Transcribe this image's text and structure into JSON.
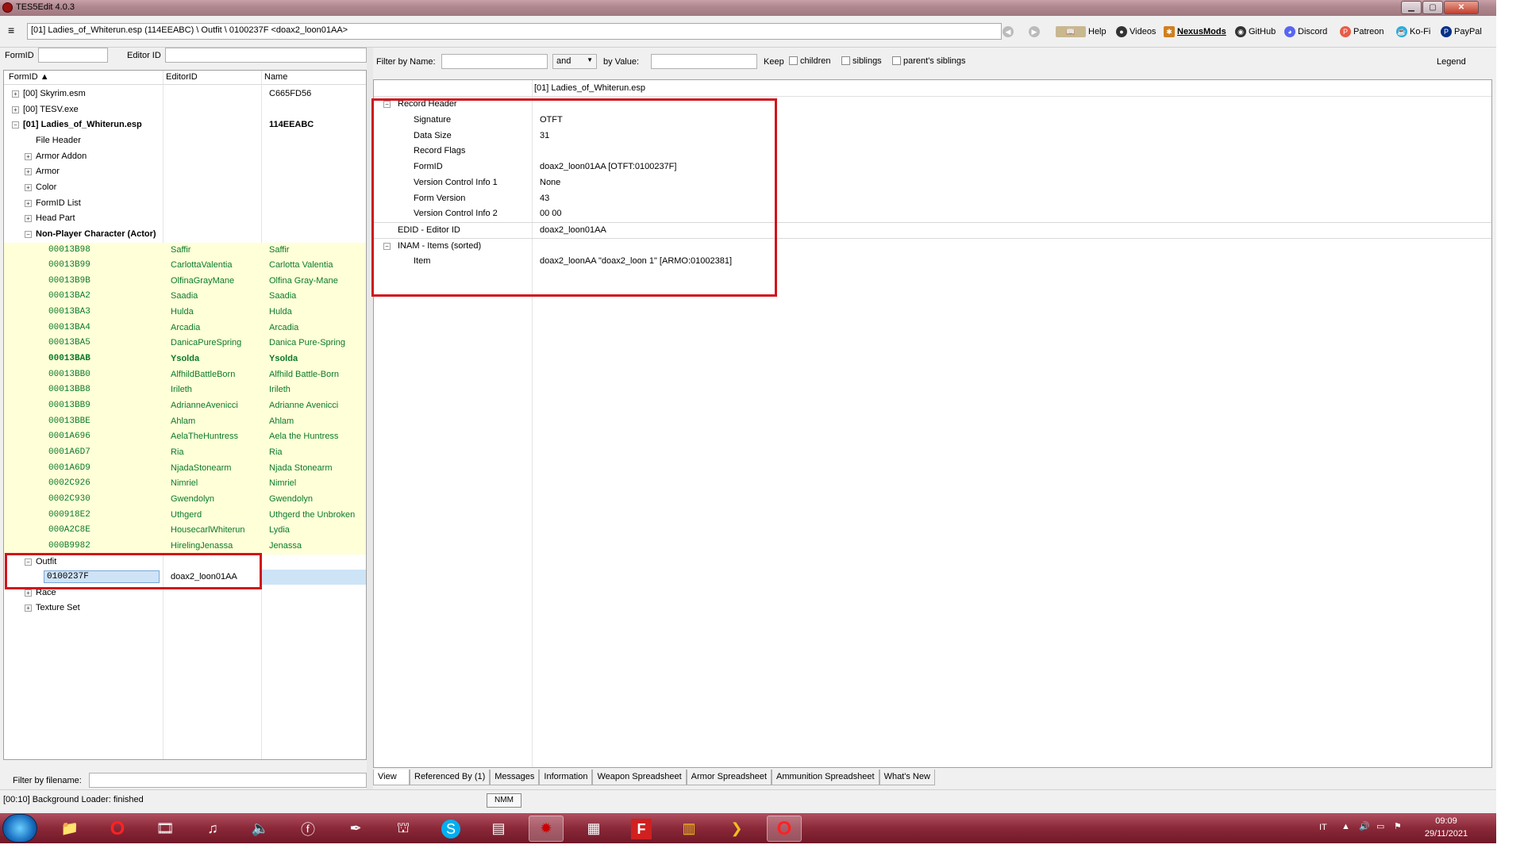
{
  "window": {
    "title": "TES5Edit 4.0.3"
  },
  "toolbar": {
    "path": "[01] Ladies_of_Whiterun.esp (114EEABC) \\ Outfit \\ 0100237F <doax2_loon01AA>",
    "links": [
      "Help",
      "Videos",
      "NexusMods",
      "GitHub",
      "Discord",
      "Patreon",
      "Ko-Fi",
      "PayPal"
    ]
  },
  "left": {
    "formid_label": "FormID",
    "editorid_label": "Editor ID",
    "columns": [
      "FormID",
      "EditorID",
      "Name"
    ],
    "filter_filename_label": "Filter by filename:"
  },
  "tree": [
    {
      "level": 0,
      "exp": "+",
      "fid": "[00] Skyrim.esm",
      "eid": "",
      "name": "C665FD56",
      "type": "file"
    },
    {
      "level": 0,
      "exp": "+",
      "fid": "[00] TESV.exe",
      "eid": "",
      "name": "",
      "type": "file"
    },
    {
      "level": 0,
      "exp": "-",
      "fid": "[01] Ladies_of_Whiterun.esp",
      "eid": "",
      "name": "114EEABC",
      "type": "file-bold"
    },
    {
      "level": 1,
      "exp": "",
      "fid": "File Header",
      "eid": "",
      "name": "",
      "type": "group"
    },
    {
      "level": 1,
      "exp": "+",
      "fid": "Armor Addon",
      "eid": "",
      "name": "",
      "type": "group"
    },
    {
      "level": 1,
      "exp": "+",
      "fid": "Armor",
      "eid": "",
      "name": "",
      "type": "group"
    },
    {
      "level": 1,
      "exp": "+",
      "fid": "Color",
      "eid": "",
      "name": "",
      "type": "group"
    },
    {
      "level": 1,
      "exp": "+",
      "fid": "FormID List",
      "eid": "",
      "name": "",
      "type": "group"
    },
    {
      "level": 1,
      "exp": "+",
      "fid": "Head Part",
      "eid": "",
      "name": "",
      "type": "group"
    },
    {
      "level": 1,
      "exp": "-",
      "fid": "Non-Player Character (Actor)",
      "eid": "",
      "name": "",
      "type": "group-bold"
    },
    {
      "level": 2,
      "exp": "",
      "fid": "00013B98",
      "eid": "Saffir",
      "name": "Saffir",
      "type": "npc"
    },
    {
      "level": 2,
      "exp": "",
      "fid": "00013B99",
      "eid": "CarlottaValentia",
      "name": "Carlotta Valentia",
      "type": "npc"
    },
    {
      "level": 2,
      "exp": "",
      "fid": "00013B9B",
      "eid": "OlfinaGrayMane",
      "name": "Olfina Gray-Mane",
      "type": "npc"
    },
    {
      "level": 2,
      "exp": "",
      "fid": "00013BA2",
      "eid": "Saadia",
      "name": "Saadia",
      "type": "npc"
    },
    {
      "level": 2,
      "exp": "",
      "fid": "00013BA3",
      "eid": "Hulda",
      "name": "Hulda",
      "type": "npc"
    },
    {
      "level": 2,
      "exp": "",
      "fid": "00013BA4",
      "eid": "Arcadia",
      "name": "Arcadia",
      "type": "npc"
    },
    {
      "level": 2,
      "exp": "",
      "fid": "00013BA5",
      "eid": "DanicaPureSpring",
      "name": "Danica Pure-Spring",
      "type": "npc"
    },
    {
      "level": 2,
      "exp": "",
      "fid": "00013BAB",
      "eid": "Ysolda",
      "name": "Ysolda",
      "type": "npc-bold"
    },
    {
      "level": 2,
      "exp": "",
      "fid": "00013BB0",
      "eid": "AlfhildBattleBorn",
      "name": "Alfhild Battle-Born",
      "type": "npc"
    },
    {
      "level": 2,
      "exp": "",
      "fid": "00013BB8",
      "eid": "Irileth",
      "name": "Irileth",
      "type": "npc"
    },
    {
      "level": 2,
      "exp": "",
      "fid": "00013BB9",
      "eid": "AdrianneAvenicci",
      "name": "Adrianne Avenicci",
      "type": "npc"
    },
    {
      "level": 2,
      "exp": "",
      "fid": "00013BBE",
      "eid": "Ahlam",
      "name": "Ahlam",
      "type": "npc"
    },
    {
      "level": 2,
      "exp": "",
      "fid": "0001A696",
      "eid": "AelaTheHuntress",
      "name": "Aela the Huntress",
      "type": "npc"
    },
    {
      "level": 2,
      "exp": "",
      "fid": "0001A6D7",
      "eid": "Ria",
      "name": "Ria",
      "type": "npc"
    },
    {
      "level": 2,
      "exp": "",
      "fid": "0001A6D9",
      "eid": "NjadaStonearm",
      "name": "Njada Stonearm",
      "type": "npc"
    },
    {
      "level": 2,
      "exp": "",
      "fid": "0002C926",
      "eid": "Nimriel",
      "name": "Nimriel",
      "type": "npc"
    },
    {
      "level": 2,
      "exp": "",
      "fid": "0002C930",
      "eid": "Gwendolyn",
      "name": "Gwendolyn",
      "type": "npc"
    },
    {
      "level": 2,
      "exp": "",
      "fid": "000918E2",
      "eid": "Uthgerd",
      "name": "Uthgerd the Unbroken",
      "type": "npc"
    },
    {
      "level": 2,
      "exp": "",
      "fid": "000A2C8E",
      "eid": "HousecarlWhiterun",
      "name": "Lydia",
      "type": "npc"
    },
    {
      "level": 2,
      "exp": "",
      "fid": "000B9982",
      "eid": "HirelingJenassa",
      "name": "Jenassa",
      "type": "npc"
    },
    {
      "level": 1,
      "exp": "-",
      "fid": "Outfit",
      "eid": "",
      "name": "",
      "type": "group"
    },
    {
      "level": 2,
      "exp": "",
      "fid": "0100237F",
      "eid": "doax2_loon01AA",
      "name": "",
      "type": "selected"
    },
    {
      "level": 1,
      "exp": "+",
      "fid": "Race",
      "eid": "",
      "name": "",
      "type": "group"
    },
    {
      "level": 1,
      "exp": "+",
      "fid": "Texture Set",
      "eid": "",
      "name": "",
      "type": "group"
    }
  ],
  "filter": {
    "by_name_label": "Filter by Name:",
    "op": "and",
    "by_value_label": "by Value:",
    "keep_label": "Keep",
    "children_label": "children",
    "siblings_label": "siblings",
    "parents_siblings_label": "parent's siblings",
    "legend_label": "Legend"
  },
  "view": {
    "header": "[01] Ladies_of_Whiterun.esp",
    "rows": [
      {
        "indent": 0,
        "exp": "-",
        "key": "Record Header",
        "val": "",
        "border": false
      },
      {
        "indent": 1,
        "exp": "",
        "key": "Signature",
        "val": "OTFT",
        "border": false
      },
      {
        "indent": 1,
        "exp": "",
        "key": "Data Size",
        "val": "31",
        "border": false
      },
      {
        "indent": 1,
        "exp": "",
        "key": "Record Flags",
        "val": "",
        "border": false
      },
      {
        "indent": 1,
        "exp": "",
        "key": "FormID",
        "val": "doax2_loon01AA [OTFT:0100237F]",
        "border": false
      },
      {
        "indent": 1,
        "exp": "",
        "key": "Version Control Info 1",
        "val": "None",
        "border": false
      },
      {
        "indent": 1,
        "exp": "",
        "key": "Form Version",
        "val": "43",
        "border": false
      },
      {
        "indent": 1,
        "exp": "",
        "key": "Version Control Info 2",
        "val": "00 00",
        "border": false
      },
      {
        "indent": 0,
        "exp": "",
        "key": "EDID - Editor ID",
        "val": "doax2_loon01AA",
        "border": true
      },
      {
        "indent": 0,
        "exp": "-",
        "key": "INAM - Items (sorted)",
        "val": "",
        "border": true
      },
      {
        "indent": 1,
        "exp": "",
        "key": "Item",
        "val": "doax2_loonAA \"doax2_loon 1\" [ARMO:01002381]",
        "border": false
      }
    ]
  },
  "tabs": [
    "View",
    "Referenced By (1)",
    "Messages",
    "Information",
    "Weapon Spreadsheet",
    "Armor Spreadsheet",
    "Ammunition Spreadsheet",
    "What's New"
  ],
  "status": "[00:10] Background Loader: finished",
  "tooltip": "NMM",
  "tray": {
    "lang": "IT",
    "time": "09:09",
    "date": "29/11/2021"
  },
  "colors": {
    "highlight_box": "#d0141c",
    "npc_row": "#ffffd8",
    "formid_green": "#0a7a2a",
    "taskbar": "#8a2838"
  }
}
